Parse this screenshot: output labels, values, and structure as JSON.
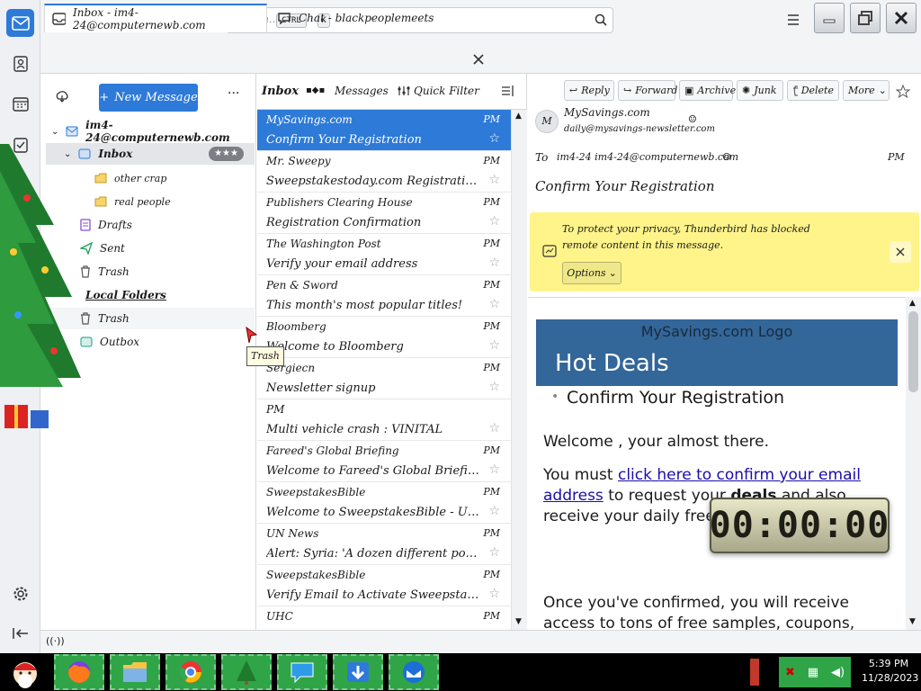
{
  "search": {
    "placeholder": "Search...",
    "key1": "CTRL",
    "key2": "K"
  },
  "tabs": [
    {
      "label": "Inbox - im4-24@computernewb.com"
    },
    {
      "label": "Chat - blackpeoplemeets"
    }
  ],
  "folders": {
    "new_message": "New Message",
    "account": "im4-24@computernewb.com",
    "inbox": "Inbox",
    "inbox_badge": "★★★",
    "sub1": "other crap",
    "sub2": "real people",
    "drafts": "Drafts",
    "sent": "Sent",
    "trash": "Trash",
    "local": "Local Folders",
    "local_trash": "Trash",
    "outbox": "Outbox"
  },
  "list": {
    "title": "Inbox",
    "count": "Messages",
    "quick_filter": "Quick Filter",
    "messages": [
      {
        "from": "MySavings.com",
        "date": "PM",
        "subject": "Confirm Your Registration",
        "selected": true
      },
      {
        "from": "Mr. Sweepy",
        "date": "PM",
        "subject": "Sweepstakestoday.com Registration Information"
      },
      {
        "from": "Publishers Clearing House",
        "date": "PM",
        "subject": "Registration Confirmation"
      },
      {
        "from": "The Washington Post",
        "date": "PM",
        "subject": "Verify your email address"
      },
      {
        "from": "Pen & Sword",
        "date": "PM",
        "subject": "This month's most popular titles!"
      },
      {
        "from": "Bloomberg",
        "date": "PM",
        "subject": "Welcome to Bloomberg"
      },
      {
        "from": "Sergiecn",
        "date": "PM",
        "subject": "Newsletter signup"
      },
      {
        "from": "PM",
        "date": "",
        "subject": "Multi vehicle crash : VINITAL"
      },
      {
        "from": "Fareed's Global Briefing",
        "date": "PM",
        "subject": "Welcome to Fareed's Global Briefing"
      },
      {
        "from": "SweepstakesBible",
        "date": "PM",
        "subject": "Welcome to SweepstakesBible - USA's L..."
      },
      {
        "from": "UN News",
        "date": "PM",
        "subject": "Alert: Syria: 'A dozen different powder kegs'"
      },
      {
        "from": "SweepstakesBible",
        "date": "PM",
        "subject": "Verify Email to Activate SweepstakesBible ..."
      },
      {
        "from": "UHC",
        "date": "PM",
        "subject": ""
      }
    ]
  },
  "reader": {
    "reply": "Reply",
    "forward": "Forward",
    "archive": "Archive",
    "junk": "Junk",
    "delete": "Delete",
    "more": "More",
    "sender_name": "MySavings.com",
    "sender_email": "daily@mysavings-newsletter.com",
    "to_label": "To",
    "to_value": "im4-24 im4-24@computernewb.com",
    "date": "PM",
    "subject": "Confirm Your Registration",
    "notice": "To protect your privacy, Thunderbird has blocked remote content in this message.",
    "options": "Options"
  },
  "email": {
    "logo_alt": "MySavings.com Logo",
    "banner": "Hot Deals",
    "bullet": "Confirm Your Registration",
    "welcome": "Welcome , your almost there.",
    "p1_a": "You must ",
    "p1_link": "click here to confirm your email address",
    "p1_b": " to request your ",
    "p1_bold": "deals",
    "p1_c": " and also receive your daily free savings.",
    "p2": "Once you've confirmed, you will receive access to tons of free samples, coupons,"
  },
  "timer": {
    "value": "00:00:00"
  },
  "tooltip": {
    "text": "Trash"
  },
  "taskbar": {
    "time": "5:39 PM",
    "date": "11/28/2023"
  },
  "colors": {
    "accent": "#2d7ad8",
    "notice": "#fff48a",
    "banner": "#336699"
  }
}
